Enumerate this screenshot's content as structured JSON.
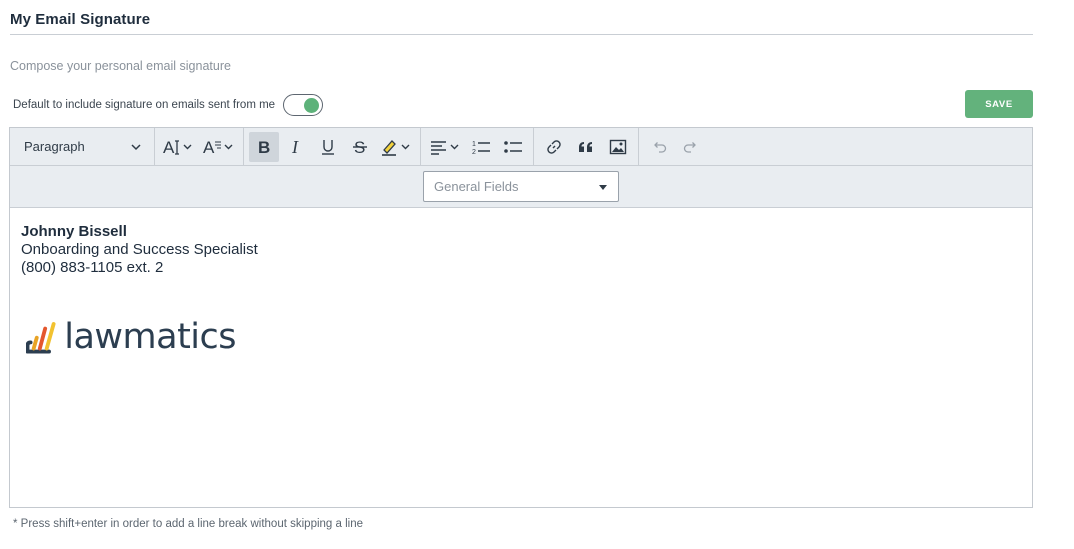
{
  "page": {
    "title": "My Email Signature",
    "subtitle": "Compose your personal email signature"
  },
  "default_toggle": {
    "label": "Default to include signature on emails sent from me",
    "enabled": true,
    "on_color": "#5db27a"
  },
  "save_button": {
    "label": "SAVE",
    "color": "#63b27c"
  },
  "toolbar": {
    "paragraph_select": "Paragraph",
    "buttons": [
      "font-size",
      "font-family",
      "bold",
      "italic",
      "underline",
      "strikethrough",
      "highlight",
      "align",
      "numbered-list",
      "bulleted-list",
      "link",
      "blockquote",
      "image",
      "undo",
      "redo"
    ],
    "bold_active": true
  },
  "fields_select": {
    "placeholder": "General Fields"
  },
  "signature": {
    "name": "Johnny Bissell",
    "role": "Onboarding and Success Specialist",
    "phone": "(800) 883-1105 ext. 2",
    "logo_text": "lawmatics",
    "logo_colors": [
      "#2c3e50",
      "#e8a325",
      "#e4572e",
      "#f2c230"
    ]
  },
  "hint": "* Press shift+enter in order to add a line break without skipping a line"
}
